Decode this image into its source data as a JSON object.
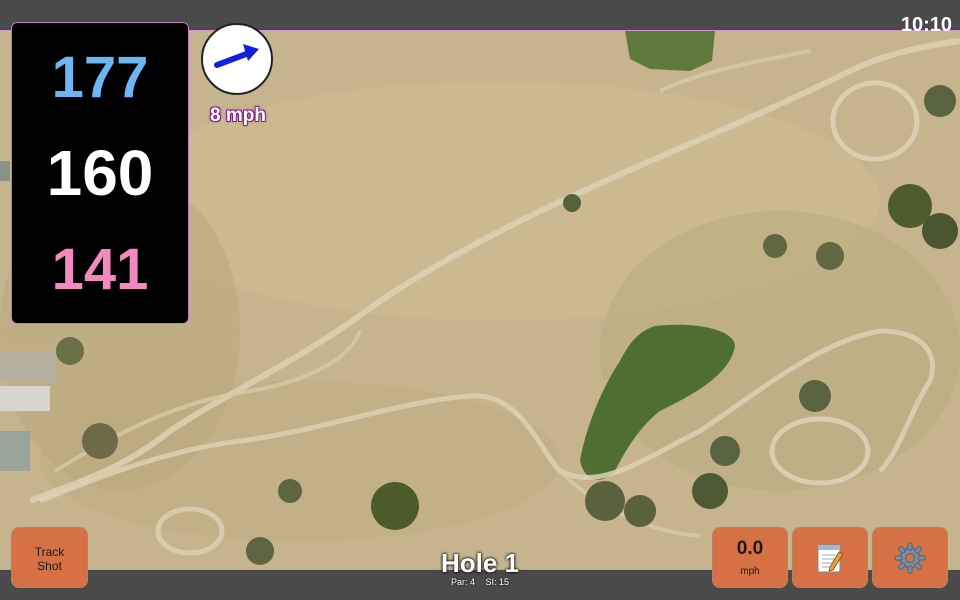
{
  "status": {
    "time": "10:10"
  },
  "yardage": {
    "back": "177",
    "middle": "160",
    "front": "141",
    "colors": {
      "back": "#6eb5f5",
      "middle": "#ffffff",
      "front": "#f28ac0"
    }
  },
  "wind": {
    "speed": "8 mph",
    "arrow_color": "#1020e0",
    "icon": "wind-arrow-icon"
  },
  "buttons": {
    "track_shot_line1": "Track",
    "track_shot_line2": "Shot",
    "speed_value": "0.0",
    "speed_unit": "mph",
    "notes_icon": "notepad-icon",
    "settings_icon": "gear-icon"
  },
  "hole": {
    "title": "Hole 1",
    "par": "Par: 4",
    "si": "SI: 15"
  },
  "colors": {
    "button": "#d57144",
    "bar": "#4a4a4a",
    "map_base": "#c7b58f"
  }
}
